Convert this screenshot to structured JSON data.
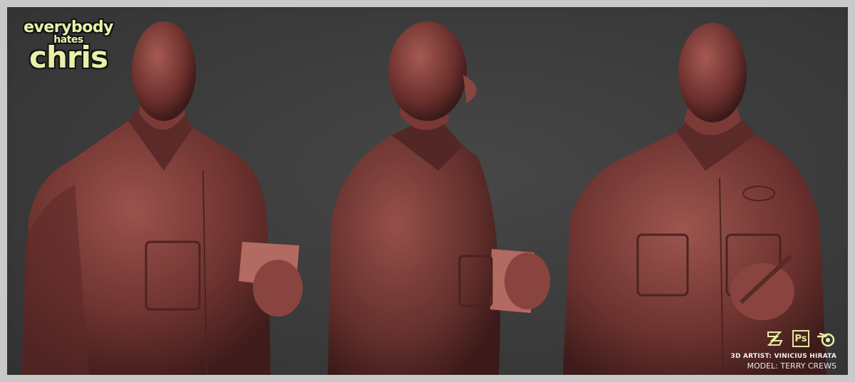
{
  "logo": {
    "line1": "everybody",
    "line2": "hates",
    "line3": "chris",
    "color": "#e9f0a8"
  },
  "render": {
    "views": [
      {
        "name": "front view"
      },
      {
        "name": "side view"
      },
      {
        "name": "three-quarter view"
      }
    ],
    "clay_color": "#7a3a36",
    "background_color": "#3a3a3a"
  },
  "tools": [
    {
      "icon": "zbrush-icon"
    },
    {
      "icon": "photoshop-icon",
      "label": "Ps"
    },
    {
      "icon": "blender-icon"
    }
  ],
  "credits": {
    "artist": "3D ARTIST: VINICIUS HIRATA",
    "model": "MODEL: TERRY CREWS"
  }
}
